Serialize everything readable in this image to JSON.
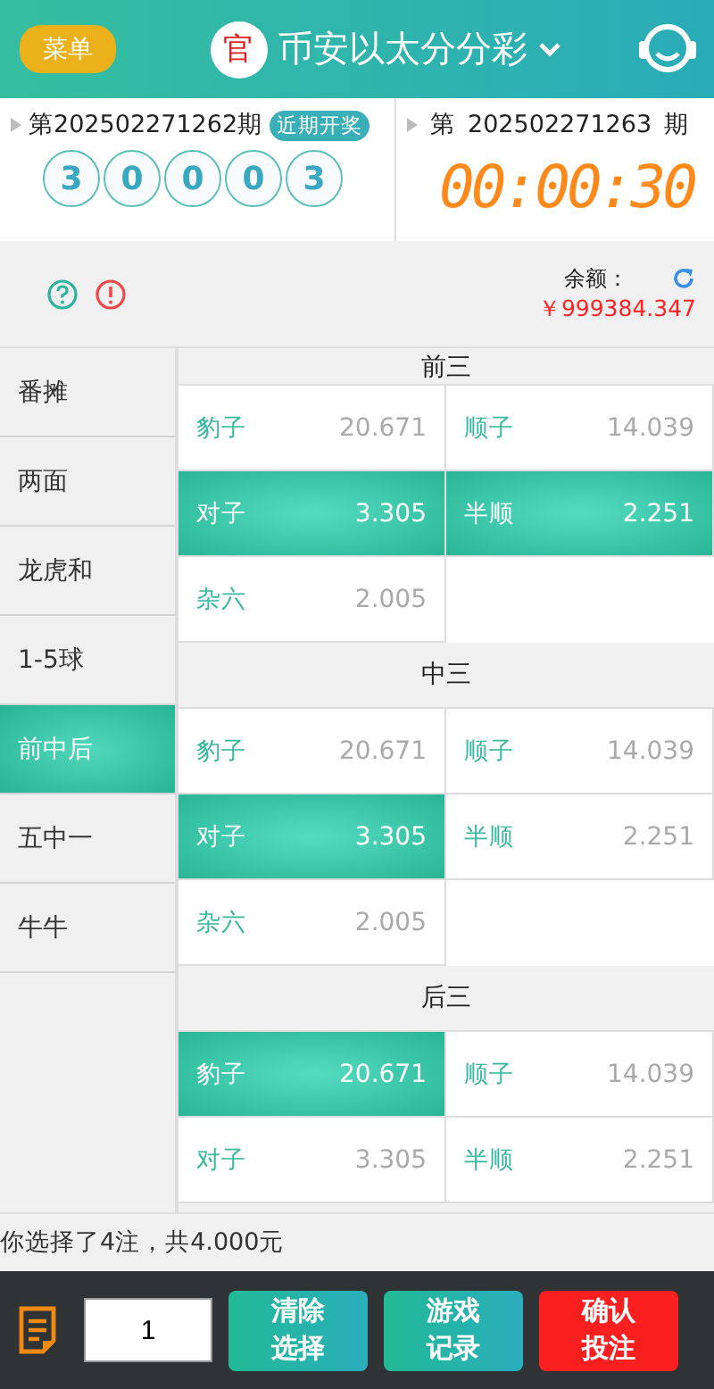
{
  "header": {
    "menu_button": "菜单",
    "badge": "官",
    "title": "币安以太分分彩"
  },
  "last_draw": {
    "period": "第202502271262期",
    "tag": "近期开奖",
    "balls": [
      "3",
      "0",
      "0",
      "0",
      "3"
    ]
  },
  "next_draw": {
    "prefix": "第",
    "period": "202502271263",
    "suffix": "期",
    "countdown": "00:00:30"
  },
  "balance": {
    "label": "余额：",
    "amount": "￥999384.347"
  },
  "sidebar": {
    "items": [
      {
        "label": "番摊",
        "selected": false
      },
      {
        "label": "两面",
        "selected": false
      },
      {
        "label": "龙虎和",
        "selected": false
      },
      {
        "label": "1-5球",
        "selected": false
      },
      {
        "label": "前中后",
        "selected": true
      },
      {
        "label": "五中一",
        "selected": false
      },
      {
        "label": "牛牛",
        "selected": false
      }
    ]
  },
  "groups": [
    {
      "title": "前三",
      "options": [
        {
          "label": "豹子",
          "odds": "20.671",
          "selected": false
        },
        {
          "label": "顺子",
          "odds": "14.039",
          "selected": false
        },
        {
          "label": "对子",
          "odds": "3.305",
          "selected": true
        },
        {
          "label": "半顺",
          "odds": "2.251",
          "selected": true
        },
        {
          "label": "杂六",
          "odds": "2.005",
          "selected": false
        }
      ]
    },
    {
      "title": "中三",
      "options": [
        {
          "label": "豹子",
          "odds": "20.671",
          "selected": false
        },
        {
          "label": "顺子",
          "odds": "14.039",
          "selected": false
        },
        {
          "label": "对子",
          "odds": "3.305",
          "selected": true
        },
        {
          "label": "半顺",
          "odds": "2.251",
          "selected": false
        },
        {
          "label": "杂六",
          "odds": "2.005",
          "selected": false
        }
      ]
    },
    {
      "title": "后三",
      "options": [
        {
          "label": "豹子",
          "odds": "20.671",
          "selected": true
        },
        {
          "label": "顺子",
          "odds": "14.039",
          "selected": false
        },
        {
          "label": "对子",
          "odds": "3.305",
          "selected": false
        },
        {
          "label": "半顺",
          "odds": "2.251",
          "selected": false
        }
      ]
    }
  ],
  "summary": "你选择了4注，共4.000元",
  "footer": {
    "multiplier": "1",
    "buttons": [
      {
        "label": "清除选择",
        "kind": "secondary"
      },
      {
        "label": "游戏记录",
        "kind": "secondary"
      },
      {
        "label": "确认投注",
        "kind": "primary"
      }
    ]
  }
}
